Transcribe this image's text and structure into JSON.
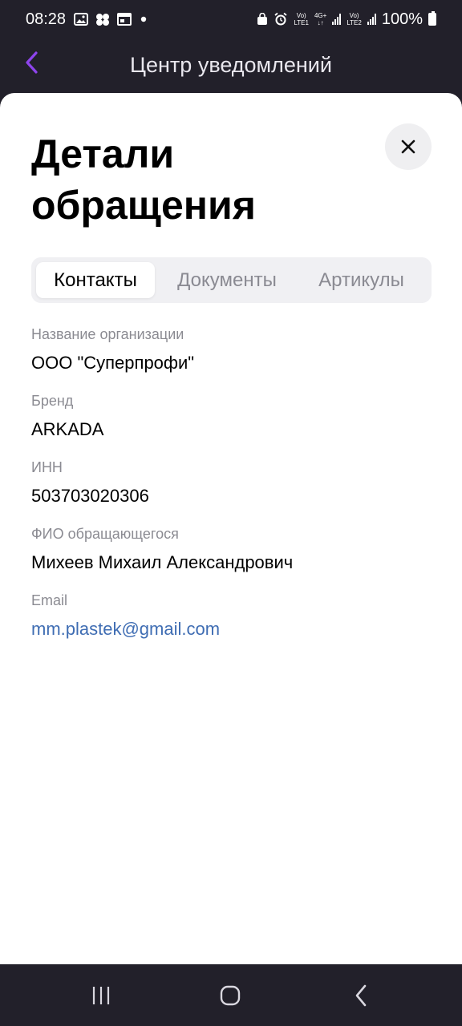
{
  "status_bar": {
    "time": "08:28",
    "network_1_top": "Vo)",
    "network_1_bottom": "LTE1",
    "network_type": "4G+",
    "network_2_top": "Vo)",
    "network_2_bottom": "LTE2",
    "battery": "100%"
  },
  "header": {
    "title": "Центр уведомлений"
  },
  "sheet": {
    "title": "Детали обращения",
    "tabs": [
      {
        "label": "Контакты",
        "active": true
      },
      {
        "label": "Документы",
        "active": false
      },
      {
        "label": "Артикулы",
        "active": false
      }
    ],
    "fields": [
      {
        "label": "Название организации",
        "value": "ООО \"Суперпрофи\""
      },
      {
        "label": "Бренд",
        "value": "ARKADA"
      },
      {
        "label": "ИНН",
        "value": "503703020306"
      },
      {
        "label": "ФИО обращающегося",
        "value": "Михеев Михаил Александрович"
      },
      {
        "label": "Email",
        "value": "mm.plastek@gmail.com"
      }
    ]
  },
  "colors": {
    "accent": "#8e44ec",
    "link": "#3f6db3",
    "dark_bg": "#22202a"
  }
}
